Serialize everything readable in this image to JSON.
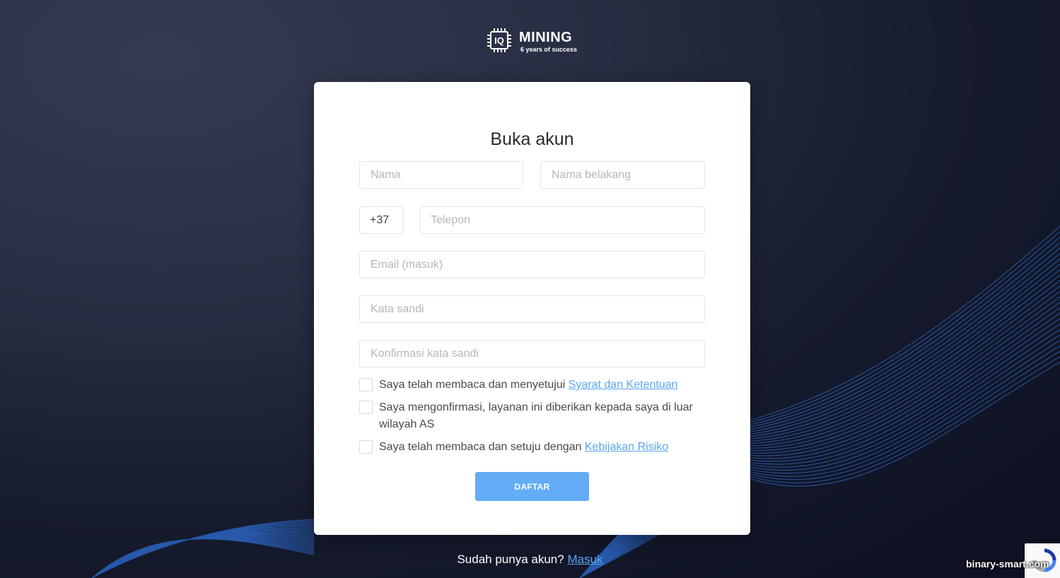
{
  "brand": {
    "chip_text": "IQ",
    "name": "MINING",
    "tagline": "6 years of success"
  },
  "form": {
    "title": "Buka akun",
    "first_name_placeholder": "Nama",
    "last_name_placeholder": "Nama belakang",
    "phone_code_value": "+37",
    "phone_placeholder": "Telepon",
    "email_placeholder": "Email (masuk)",
    "password_placeholder": "Kata sandi",
    "confirm_password_placeholder": "Konfirmasi kata sandi",
    "checks": [
      {
        "text": "Saya telah membaca dan menyetujui",
        "link": "Syarat dan Ketentuan",
        "checked": false
      },
      {
        "text": "Saya mengonfirmasi, layanan ini diberikan kepada saya di luar wilayah AS",
        "link": "",
        "checked": false
      },
      {
        "text": "Saya telah membaca dan setuju dengan",
        "link": "Kebijakan Risiko",
        "checked": false
      }
    ],
    "submit_label": "DAFTAR"
  },
  "footer": {
    "text": "Sudah punya akun?",
    "login_link": "Masuk"
  },
  "watermark": "binary-smart.com",
  "colors": {
    "accent": "#63acf6",
    "link": "#5aa6f0",
    "background_dark": "#0c1020",
    "wave": "#2f6fd6"
  }
}
